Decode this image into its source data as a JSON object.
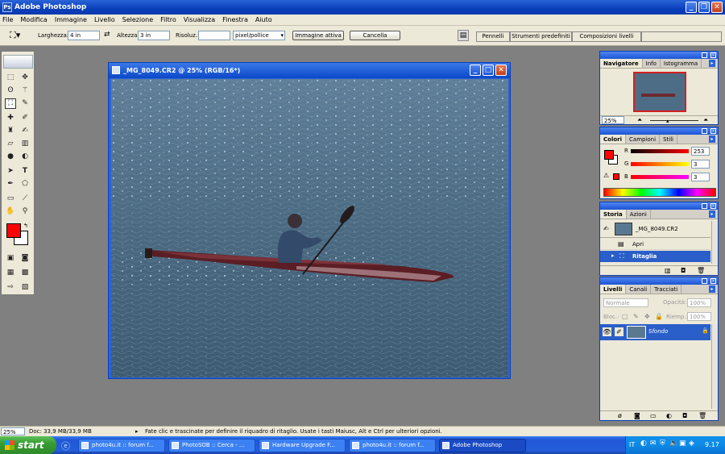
{
  "app": {
    "title": "Adobe Photoshop"
  },
  "menu": [
    "File",
    "Modifica",
    "Immagine",
    "Livello",
    "Selezione",
    "Filtro",
    "Visualizza",
    "Finestra",
    "Aiuto"
  ],
  "options": {
    "width_label": "Larghezza:",
    "width_value": "4 in",
    "height_label": "Altezza:",
    "height_value": "3 in",
    "resolution_label": "Risoluz.:",
    "resolution_value": "",
    "unit_value": "pixel/pollice",
    "front_image_button": "Immagine attiva",
    "clear_button": "Cancella",
    "wells": [
      "Pennelli",
      "Strumenti predefiniti",
      "Composizioni livelli"
    ]
  },
  "document": {
    "title": "_MG_8049.CR2 @ 25% (RGB/16*)"
  },
  "navigator": {
    "tabs": [
      "Navigatore",
      "Info",
      "Istogramma"
    ],
    "zoom": "25%"
  },
  "colors": {
    "tabs": [
      "Colori",
      "Campioni",
      "Stili"
    ],
    "r_label": "R",
    "g_label": "G",
    "b_label": "B",
    "r_value": "253",
    "g_value": "3",
    "b_value": "3",
    "foreground": "#fd0303",
    "background": "#ffffff"
  },
  "history": {
    "tabs": [
      "Storia",
      "Azioni"
    ],
    "snapshot": "_MG_8049.CR2",
    "steps": [
      "Apri",
      "Ritaglia"
    ]
  },
  "layers": {
    "tabs": [
      "Livelli",
      "Canali",
      "Tracciati"
    ],
    "blend_mode": "Normale",
    "opacity_label": "Opacità:",
    "opacity_value": "100%",
    "lock_label": "Bloc.:",
    "fill_label": "Riemp.:",
    "fill_value": "100%",
    "layer_name": "Sfondo"
  },
  "status": {
    "zoom": "25%",
    "doc": "Doc: 33,9 MB/33,9 MB",
    "hint": "Fate clic e trascinate per definire il riquadro di ritaglio. Usate i tasti Maiusc, Alt e Ctrl per ulteriori opzioni."
  },
  "taskbar": {
    "start": "start",
    "tasks": [
      "photo4u.it :: forum f...",
      "PhotoSOB :: Cerca - ...",
      "Hardware Upgrade F...",
      "photo4u.it :: forum f...",
      "Adobe Photoshop"
    ],
    "lang": "IT",
    "clock": "9.17"
  },
  "accent": "#2a63d8"
}
